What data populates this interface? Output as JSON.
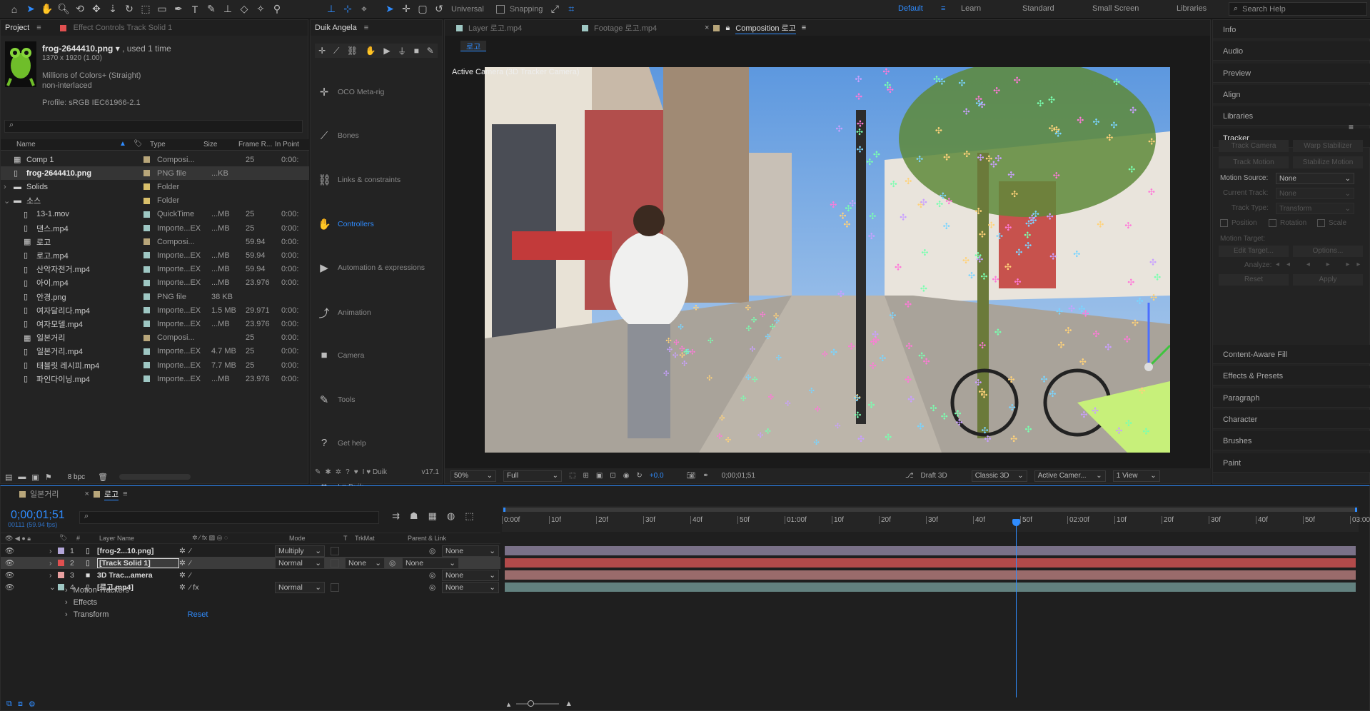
{
  "toolbar": {
    "universal_label": "Universal",
    "snapping_label": "Snapping",
    "workspaces": [
      "Default",
      "Learn",
      "Standard",
      "Small Screen",
      "Libraries"
    ],
    "active_workspace": "Default",
    "search_placeholder": "Search Help"
  },
  "project": {
    "tab_label": "Project",
    "effect_tab_label": "Effect Controls Track Solid 1",
    "item_name": "frog-2644410.png",
    "used_text": ", used 1 time",
    "dims": "1370 x 1920 (1.00)",
    "colors": "Millions of Colors+ (Straight)",
    "interlace": "non-interlaced",
    "profile": "Profile: sRGB IEC61966-2.1",
    "columns": {
      "name": "Name",
      "type": "Type",
      "size": "Size",
      "rate": "Frame R...",
      "inpoint": "In Point"
    },
    "rows": [
      {
        "name": "Comp 1",
        "type": "Composi...",
        "size": "",
        "rate": "25",
        "inp": "0:00:",
        "color": "#b8a67a",
        "indent": 0
      },
      {
        "name": "frog-2644410.png",
        "type": "PNG file",
        "size": "...KB",
        "rate": "",
        "inp": "",
        "color": "#b8a67a",
        "indent": 0
      },
      {
        "name": "Solids",
        "type": "Folder",
        "size": "",
        "rate": "",
        "inp": "",
        "color": "#d9c06b",
        "indent": 0
      },
      {
        "name": "소스",
        "type": "Folder",
        "size": "",
        "rate": "",
        "inp": "",
        "color": "#d9c06b",
        "indent": 0
      },
      {
        "name": "13-1.mov",
        "type": "QuickTime",
        "size": "...MB",
        "rate": "25",
        "inp": "0:00:",
        "color": "#9ec7c3",
        "indent": 1
      },
      {
        "name": "댄스.mp4",
        "type": "Importe...EX",
        "size": "...MB",
        "rate": "25",
        "inp": "0:00:",
        "color": "#9ec7c3",
        "indent": 1
      },
      {
        "name": "로고",
        "type": "Composi...",
        "size": "",
        "rate": "59.94",
        "inp": "0:00:",
        "color": "#b8a67a",
        "indent": 1
      },
      {
        "name": "로고.mp4",
        "type": "Importe...EX",
        "size": "...MB",
        "rate": "59.94",
        "inp": "0:00:",
        "color": "#9ec7c3",
        "indent": 1
      },
      {
        "name": "산악자전거.mp4",
        "type": "Importe...EX",
        "size": "...MB",
        "rate": "59.94",
        "inp": "0:00:",
        "color": "#9ec7c3",
        "indent": 1
      },
      {
        "name": "아이.mp4",
        "type": "Importe...EX",
        "size": "...MB",
        "rate": "23.976",
        "inp": "0:00:",
        "color": "#9ec7c3",
        "indent": 1
      },
      {
        "name": "안경.png",
        "type": "PNG file",
        "size": "38 KB",
        "rate": "",
        "inp": "",
        "color": "#9ec7c3",
        "indent": 1
      },
      {
        "name": "여자달리다.mp4",
        "type": "Importe...EX",
        "size": "1.5 MB",
        "rate": "29.971",
        "inp": "0:00:",
        "color": "#9ec7c3",
        "indent": 1
      },
      {
        "name": "여자모델.mp4",
        "type": "Importe...EX",
        "size": "...MB",
        "rate": "23.976",
        "inp": "0:00:",
        "color": "#9ec7c3",
        "indent": 1
      },
      {
        "name": "일본거리",
        "type": "Composi...",
        "size": "",
        "rate": "25",
        "inp": "0:00:",
        "color": "#b8a67a",
        "indent": 1
      },
      {
        "name": "일본거리.mp4",
        "type": "Importe...EX",
        "size": "4.7 MB",
        "rate": "25",
        "inp": "0:00:",
        "color": "#9ec7c3",
        "indent": 1
      },
      {
        "name": "태블릿 레시피.mp4",
        "type": "Importe...EX",
        "size": "7.7 MB",
        "rate": "25",
        "inp": "0:00:",
        "color": "#9ec7c3",
        "indent": 1
      },
      {
        "name": "파인다이닝.mp4",
        "type": "Importe...EX",
        "size": "...MB",
        "rate": "23.976",
        "inp": "0:00:",
        "color": "#9ec7c3",
        "indent": 1
      }
    ],
    "bpc": "8 bpc"
  },
  "duik": {
    "title": "Duik Angela",
    "items": [
      "OCO Meta-rig",
      "Bones",
      "Links & constraints",
      "Controllers",
      "Automation & expressions",
      "Animation",
      "Camera",
      "Tools",
      "Get help",
      "I ♥ Duik"
    ],
    "active": "Controllers",
    "footer_label": "I ♥ Duik",
    "version": "v17.1"
  },
  "viewer": {
    "tabs": [
      {
        "label": "Layer 로고.mp4"
      },
      {
        "label": "Footage 로고.mp4"
      },
      {
        "label": "Composition 로고"
      }
    ],
    "comp_chip": "로고",
    "camera_label": "Active Camera (3D Tracker Camera)",
    "zoom": "50%",
    "resolution": "Full",
    "exposure": "+0.0",
    "timecode": "0;00;01;51",
    "draft": "Draft 3D",
    "renderer": "Classic 3D",
    "camera_sel": "Active Camer...",
    "views": "1 View"
  },
  "right_panel": {
    "items": [
      "Info",
      "Audio",
      "Preview",
      "Align",
      "Libraries",
      "Tracker"
    ],
    "tracker": {
      "track_camera": "Track Camera",
      "warp_stabilizer": "Warp Stabilizer",
      "track_motion": "Track Motion",
      "stabilize_motion": "Stabilize Motion",
      "motion_source_label": "Motion Source:",
      "motion_source": "None",
      "current_track_label": "Current Track:",
      "current_track": "None",
      "track_type_label": "Track Type:",
      "track_type": "Transform",
      "position": "Position",
      "rotation": "Rotation",
      "scale": "Scale",
      "motion_target": "Motion Target:",
      "edit_target": "Edit Target...",
      "options": "Options...",
      "analyze": "Analyze:",
      "reset": "Reset",
      "apply": "Apply"
    },
    "bottom_items": [
      "Content-Aware Fill",
      "Effects & Presets",
      "Paragraph",
      "Character",
      "Brushes",
      "Paint"
    ]
  },
  "timeline": {
    "tabs": [
      "일본거리",
      "로고"
    ],
    "active_tab": "로고",
    "timecode": "0;00;01;51",
    "frame_info": "00111 (59.94 fps)",
    "columns": {
      "layer_name": "Layer Name",
      "mode": "Mode",
      "t": "T",
      "trkmat": "TrkMat",
      "parent": "Parent & Link"
    },
    "ruler": [
      "0:00f",
      "10f",
      "20f",
      "30f",
      "40f",
      "50f",
      "01:00f",
      "10f",
      "20f",
      "30f",
      "40f",
      "50f",
      "02:00f",
      "10f",
      "20f",
      "30f",
      "40f",
      "50f",
      "03:00"
    ],
    "playhead_pct": 0.604,
    "layers": [
      {
        "num": "1",
        "name": "[frog-2...10.png]",
        "color": "#b3a6d8",
        "mode": "Multiply",
        "trkmat": "",
        "parent": "None",
        "bar": "#7a7188"
      },
      {
        "num": "2",
        "name": "[Track Solid 1]",
        "color": "#e05050",
        "mode": "Normal",
        "trkmat": "None",
        "parent": "None",
        "bar": "#b24a4a"
      },
      {
        "num": "3",
        "name": "3D Trac...amera",
        "color": "#e8a0a0",
        "mode": "",
        "trkmat": "",
        "parent": "None",
        "bar": "#9a6b6b"
      },
      {
        "num": "4",
        "name": "[로고.mp4]",
        "color": "#9ec7c3",
        "mode": "Normal",
        "trkmat": "",
        "parent": "None",
        "bar": "#62817f"
      }
    ],
    "props": [
      "Motion Trackers",
      "Effects",
      "Transform"
    ],
    "reset_label": "Reset"
  }
}
